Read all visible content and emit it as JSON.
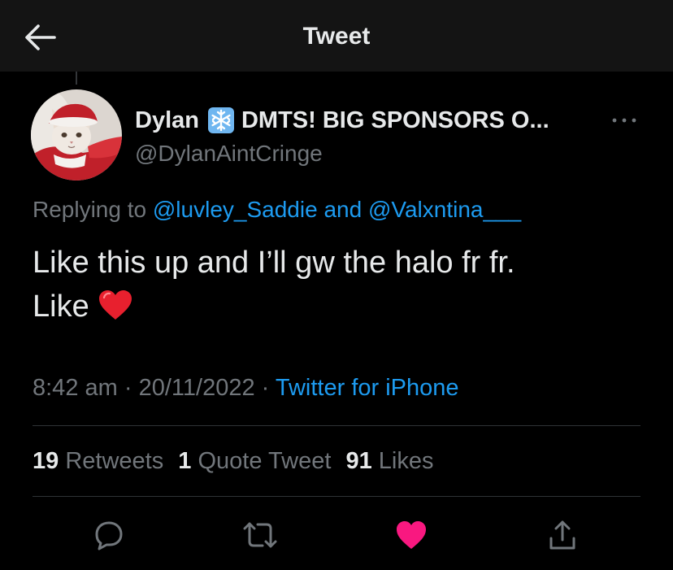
{
  "header": {
    "title": "Tweet",
    "back_icon": "back-arrow-icon"
  },
  "author": {
    "name": "Dylan",
    "name_suffix": "DMTS! BIG SPONSORS O...",
    "name_emoji": "snowflake-icon",
    "handle": "@DylanAintCringe",
    "avatar": "avatar-cat-santa"
  },
  "reply": {
    "prefix": "Replying to",
    "mention_1": "@luvley_Saddie",
    "joiner": "and",
    "mention_2": "@Valxntina___"
  },
  "tweet": {
    "line_1": "Like this up and I’ll gw the halo fr fr.",
    "line_2": "Like",
    "emoji": "red-heart-emoji"
  },
  "meta": {
    "time": "8:42 am",
    "sep": "·",
    "date": "20/11/2022",
    "source": "Twitter for iPhone"
  },
  "stats": {
    "retweets_count": "19",
    "retweets_label": "Retweets",
    "quotes_count": "1",
    "quotes_label": "Quote Tweet",
    "likes_count": "91",
    "likes_label": "Likes"
  },
  "actions": {
    "reply_icon": "reply-icon",
    "retweet_icon": "retweet-icon",
    "like_icon": "heart-icon",
    "share_icon": "share-icon",
    "liked": true
  },
  "colors": {
    "background": "#000000",
    "header_background": "#141414",
    "primary_text": "#e7e9ea",
    "secondary_text": "#71767b",
    "link": "#1d9bf0",
    "like": "#f91880",
    "divider": "#2f3336"
  }
}
